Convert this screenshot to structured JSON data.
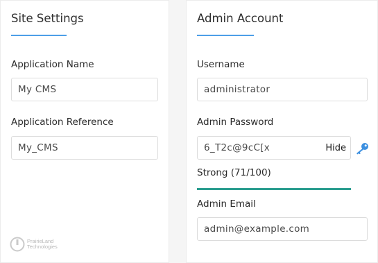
{
  "site_settings": {
    "title": "Site Settings",
    "app_name_label": "Application Name",
    "app_name_value": "My CMS",
    "app_ref_label": "Application Reference",
    "app_ref_value": "My_CMS",
    "logo_line1": "PrairieLand",
    "logo_line2": "Technologies"
  },
  "admin_account": {
    "title": "Admin Account",
    "username_label": "Username",
    "username_value": "administrator",
    "password_label": "Admin Password",
    "password_value": "6_T2c@9cC[x",
    "hide_label": "Hide",
    "strength_text": "Strong (71/100)",
    "strength_score": 71,
    "strength_max": 100,
    "email_label": "Admin Email",
    "email_value": "admin@example.com"
  },
  "colors": {
    "accent": "#4d9fe8",
    "strength": "#2a9d8f",
    "key_icon": "#3b8fe0"
  },
  "icons": {
    "key": "key-icon",
    "logo": "prairieland-logo-icon"
  }
}
